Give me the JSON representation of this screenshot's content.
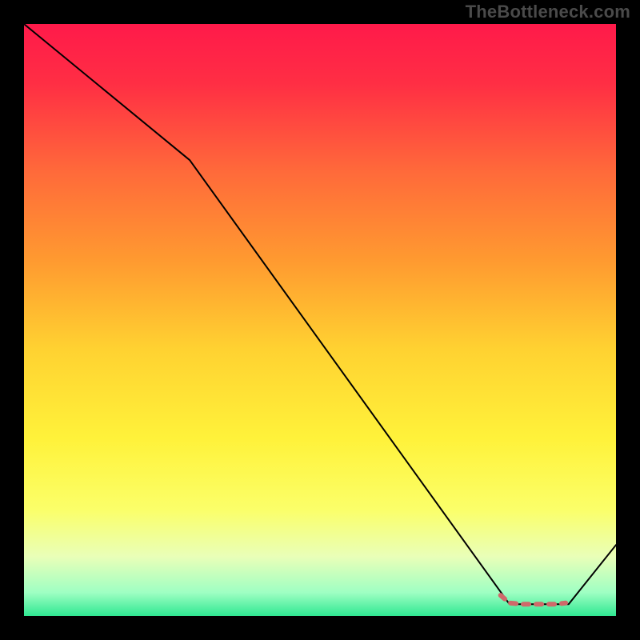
{
  "watermark": "TheBottleneck.com",
  "chart_data": {
    "type": "line",
    "title": "",
    "xlabel": "",
    "ylabel": "",
    "xlim": [
      0,
      100
    ],
    "ylim": [
      0,
      100
    ],
    "grid": false,
    "legend": false,
    "series": [
      {
        "name": "curve",
        "x": [
          0,
          28,
          82,
          92,
          100
        ],
        "y": [
          100,
          77,
          2,
          2,
          12
        ],
        "color": "#000000",
        "width": 2
      },
      {
        "name": "highlight",
        "x": [
          80.5,
          82,
          84,
          86,
          88,
          90,
          91.5
        ],
        "y": [
          3.5,
          2.2,
          2.0,
          2.0,
          2.0,
          2.0,
          2.2
        ],
        "color": "#cf6a6a",
        "width": 6,
        "dashed": true
      }
    ],
    "gradient_stops": [
      {
        "offset": 0.0,
        "color": "#ff1a4a"
      },
      {
        "offset": 0.1,
        "color": "#ff2e44"
      },
      {
        "offset": 0.25,
        "color": "#ff6a3a"
      },
      {
        "offset": 0.4,
        "color": "#ff9a30"
      },
      {
        "offset": 0.55,
        "color": "#ffd231"
      },
      {
        "offset": 0.7,
        "color": "#fff23a"
      },
      {
        "offset": 0.82,
        "color": "#fbff69"
      },
      {
        "offset": 0.9,
        "color": "#e9ffb8"
      },
      {
        "offset": 0.96,
        "color": "#9fffc3"
      },
      {
        "offset": 1.0,
        "color": "#2fe892"
      }
    ]
  }
}
